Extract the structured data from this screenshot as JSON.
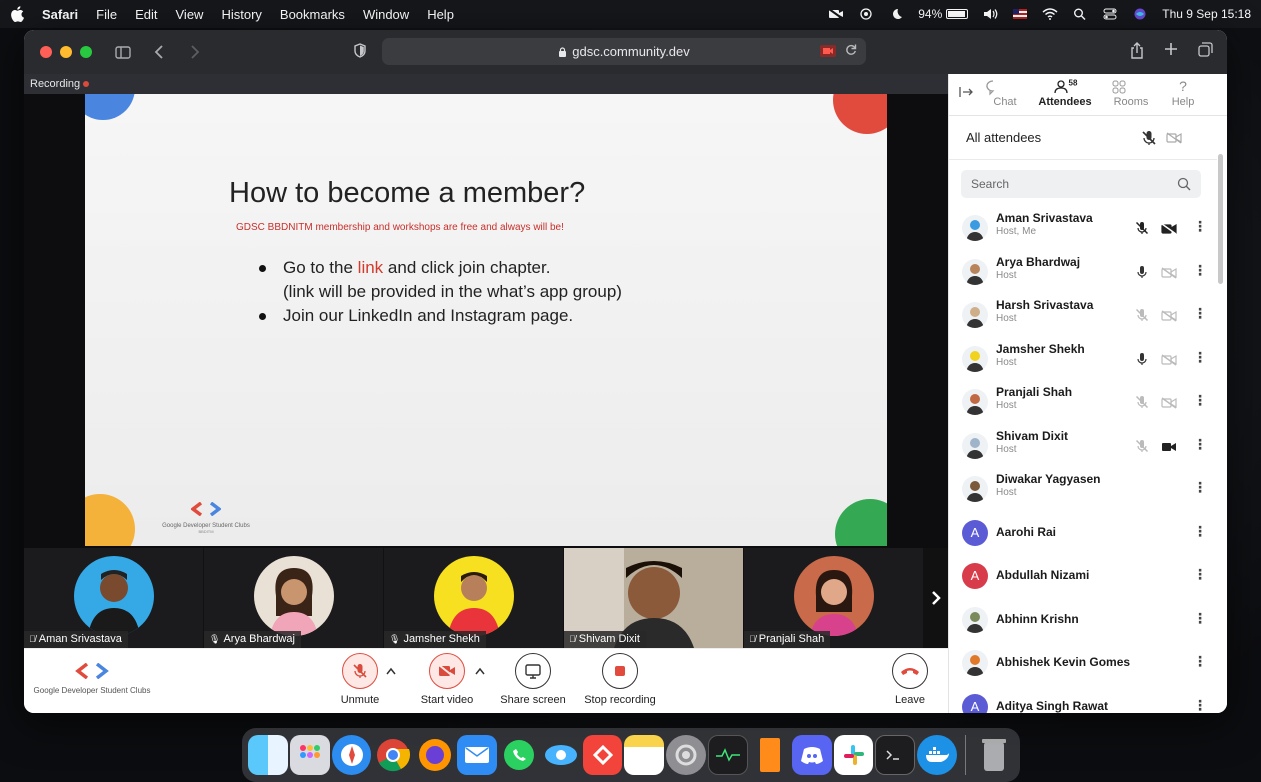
{
  "menubar": {
    "app": "Safari",
    "items": [
      "File",
      "Edit",
      "View",
      "History",
      "Bookmarks",
      "Window",
      "Help"
    ],
    "battery": "94%",
    "datetime": "Thu 9 Sep  15:18"
  },
  "browser": {
    "url": "gdsc.community.dev"
  },
  "meeting": {
    "recording_label": "Recording",
    "slide": {
      "title": "How to become a member?",
      "subtitle": "GDSC BBDNITM membership and workshops are free and always will be!",
      "bullet1_pre": "Go to the ",
      "bullet1_link": "link",
      "bullet1_post": " and click join chapter.",
      "bullet1_cont": "(link will be provided in the what’s app group)",
      "bullet2": "Join our LinkedIn and Instagram page.",
      "logo_text": "Google Developer Student Clubs",
      "logo_sub": "BBDITM"
    },
    "thumbnails": [
      {
        "name": "Aman Srivastava",
        "muted": true,
        "bg": "#35a8e6"
      },
      {
        "name": "Arya Bhardwaj",
        "muted": false,
        "bg": "#e9e1d6"
      },
      {
        "name": "Jamsher Shekh",
        "muted": false,
        "bg": "#f6e01f"
      },
      {
        "name": "Shivam Dixit",
        "muted": true,
        "bg": "#8a7a66"
      },
      {
        "name": "Pranjali Shah",
        "muted": true,
        "bg": "#c96a4a"
      }
    ]
  },
  "controls": {
    "logo_text": "Google Developer Student Clubs",
    "unmute": "Unmute",
    "start_video": "Start video",
    "share_screen": "Share screen",
    "stop_recording": "Stop recording",
    "leave": "Leave"
  },
  "panel": {
    "tabs": {
      "chat": "Chat",
      "attendees": "Attendees",
      "attendees_count": "58",
      "rooms": "Rooms",
      "help": "Help"
    },
    "all_attendees": "All attendees",
    "search_placeholder": "Search",
    "attendees": [
      {
        "name": "Aman Srivastava",
        "role": "Host, Me",
        "avatar": "photo",
        "avatar_color": "#3a9be0",
        "mic": "muted-dark",
        "cam": "off-dark"
      },
      {
        "name": "Arya Bhardwaj",
        "role": "Host",
        "avatar": "photo",
        "avatar_color": "#b8845c",
        "mic": "on",
        "cam": "off-light"
      },
      {
        "name": "Harsh Srivastava",
        "role": "Host",
        "avatar": "photo",
        "avatar_color": "#cfae8a",
        "mic": "muted-light",
        "cam": "off-light"
      },
      {
        "name": "Jamsher Shekh",
        "role": "Host",
        "avatar": "photo",
        "avatar_color": "#f1d21e",
        "mic": "on",
        "cam": "off-light"
      },
      {
        "name": "Pranjali Shah",
        "role": "Host",
        "avatar": "photo",
        "avatar_color": "#c06a45",
        "mic": "muted-light",
        "cam": "off-light"
      },
      {
        "name": "Shivam Dixit",
        "role": "Host",
        "avatar": "photo",
        "avatar_color": "#9fb4c8",
        "mic": "muted-light",
        "cam": "on"
      },
      {
        "name": "Diwakar Yagyasen",
        "role": "Host",
        "avatar": "photo",
        "avatar_color": "#7a5a3a",
        "mic": "",
        "cam": ""
      },
      {
        "name": "Aarohi Rai",
        "role": "",
        "avatar": "A",
        "avatar_color": "#5b5bd6",
        "mic": "",
        "cam": ""
      },
      {
        "name": "Abdullah Nizami",
        "role": "",
        "avatar": "A",
        "avatar_color": "#d83b4a",
        "mic": "",
        "cam": ""
      },
      {
        "name": "Abhinn Krishn",
        "role": "",
        "avatar": "photo",
        "avatar_color": "#7b8a5a",
        "mic": "",
        "cam": ""
      },
      {
        "name": "Abhishek Kevin Gomes",
        "role": "",
        "avatar": "photo",
        "avatar_color": "#e07a2a",
        "mic": "",
        "cam": ""
      },
      {
        "name": "Aditya Singh Rawat",
        "role": "",
        "avatar": "A",
        "avatar_color": "#5b5bd6",
        "mic": "",
        "cam": ""
      }
    ]
  },
  "dock": {
    "apps": [
      "finder-icon",
      "launchpad-icon",
      "safari-icon",
      "chrome-icon",
      "firefox-icon",
      "mail-icon",
      "whatsapp-icon",
      "preview-icon",
      "anydesk-icon",
      "notes-icon",
      "system-preferences-icon",
      "activity-monitor-icon",
      "books-icon",
      "discord-icon",
      "slack-icon",
      "terminal-icon",
      "docker-icon",
      "trash-icon"
    ]
  }
}
